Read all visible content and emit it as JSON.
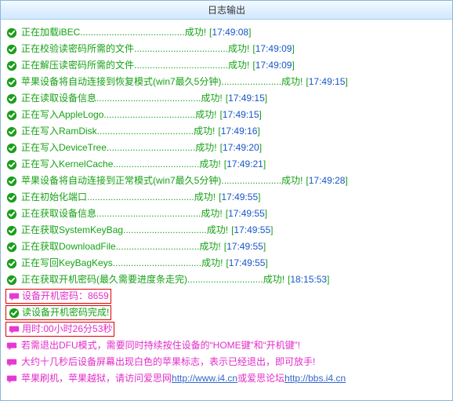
{
  "title": "日志输出",
  "success_label": "成功!",
  "entries": [
    {
      "kind": "ok",
      "text": "正在加载iBEC",
      "ts": "17:49:08"
    },
    {
      "kind": "ok",
      "text": "正在校验读密码所需的文件",
      "ts": "17:49:09"
    },
    {
      "kind": "ok",
      "text": "正在解压读密码所需的文件",
      "ts": "17:49:09"
    },
    {
      "kind": "ok",
      "text": "苹果设备将自动连接到恢复模式(win7最久5分钟)",
      "ts": "17:49:15"
    },
    {
      "kind": "ok",
      "text": "正在读取设备信息",
      "ts": "17:49:15"
    },
    {
      "kind": "ok",
      "text": "正在写入AppleLogo",
      "ts": "17:49:15"
    },
    {
      "kind": "ok",
      "text": "正在写入RamDisk",
      "ts": "17:49:16"
    },
    {
      "kind": "ok",
      "text": "正在写入DeviceTree",
      "ts": "17:49:20"
    },
    {
      "kind": "ok",
      "text": "正在写入KernelCache",
      "ts": "17:49:21"
    },
    {
      "kind": "ok",
      "text": "苹果设备将自动连接到正常模式(win7最久5分钟)",
      "ts": "17:49:28"
    },
    {
      "kind": "ok",
      "text": "正在初始化端口",
      "ts": "17:49:55"
    },
    {
      "kind": "ok",
      "text": "正在获取设备信息",
      "ts": "17:49:55"
    },
    {
      "kind": "ok",
      "text": "正在获取SystemKeyBag",
      "ts": "17:49:55"
    },
    {
      "kind": "ok",
      "text": "正在获取DownloadFile",
      "ts": "17:49:55"
    },
    {
      "kind": "ok",
      "text": "正在写回KeyBagKeys",
      "ts": "17:49:55"
    },
    {
      "kind": "ok",
      "text": "正在获取开机密码(最久需要进度条走完)",
      "ts": "18:15:53"
    },
    {
      "kind": "boxed-magenta",
      "text": "设备开机密码：8659"
    },
    {
      "kind": "boxed-green",
      "text": "读设备开机密码完成!"
    },
    {
      "kind": "boxed-magenta",
      "text": "用时:00小时26分53秒"
    },
    {
      "kind": "magenta",
      "text": "若需退出DFU模式，需要同时持续按住设备的“HOME键”和“开机键”!"
    },
    {
      "kind": "magenta",
      "text": "大约十几秒后设备屏幕出现白色的苹果标志，表示已经退出，即可放手!"
    },
    {
      "kind": "mixed",
      "parts": [
        {
          "t": "苹果刷机，苹果越狱，请访问爱思网",
          "cls": "msg-magenta"
        },
        {
          "t": "http://www.i4.cn",
          "cls": "msg-link"
        },
        {
          "t": "或爱思论坛",
          "cls": "msg-magenta"
        },
        {
          "t": "http://bbs.i4.cn",
          "cls": "msg-link"
        }
      ]
    }
  ]
}
